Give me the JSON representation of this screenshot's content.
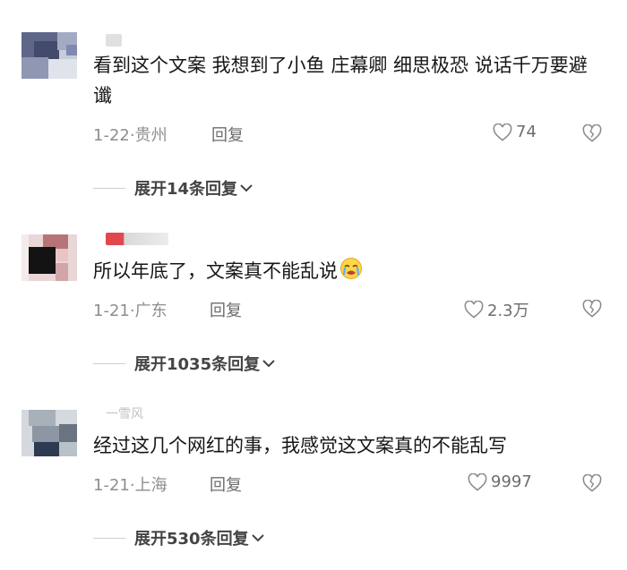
{
  "comments": [
    {
      "username": "",
      "text": "看到这个文案 我想到了小鱼 庄幕卿 细思极恐 说话千万要避谶",
      "date": "1-22",
      "location": "贵州",
      "reply_label": "回复",
      "likes": "74",
      "expand_label": "展开14条回复"
    },
    {
      "username": "",
      "text": "所以年底了，文案真不能乱说",
      "emoji_name": "crying-face-emoji",
      "date": "1-21",
      "location": "广东",
      "reply_label": "回复",
      "likes": "2.3万",
      "expand_label": "展开1035条回复"
    },
    {
      "username": "一雪风",
      "text": "经过这几个网红的事，我感觉这文案真的不能乱写",
      "date": "1-21",
      "location": "上海",
      "reply_label": "回复",
      "likes": "9997",
      "expand_label": "展开530条回复"
    }
  ],
  "meta_separator": "·",
  "icons": {
    "like": "heart-outline-icon",
    "dislike": "broken-heart-icon",
    "expand": "chevron-down-icon"
  },
  "colors": {
    "text": "#161616",
    "meta": "#8e8e8e",
    "expand": "#444444"
  }
}
